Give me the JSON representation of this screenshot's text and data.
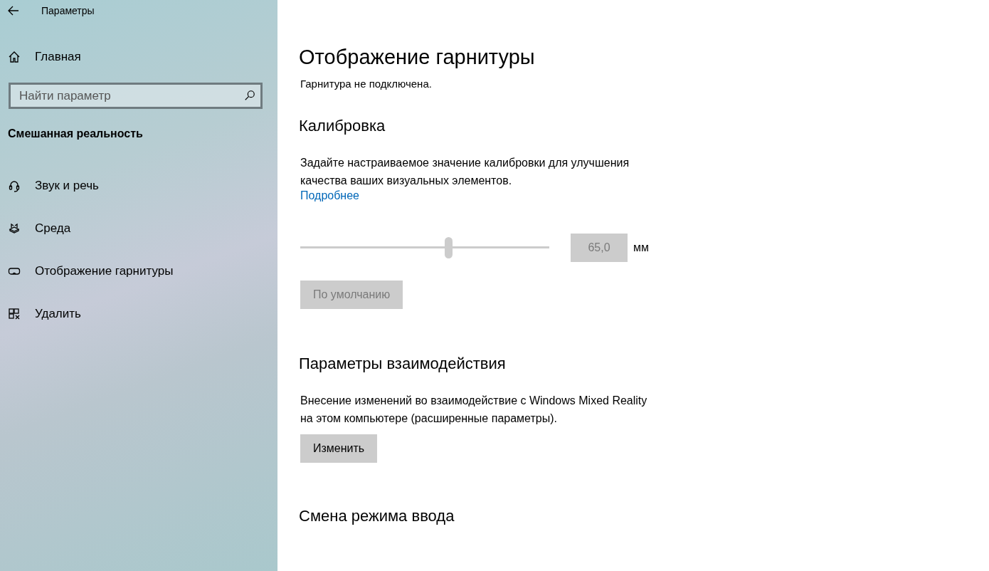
{
  "window": {
    "title": "Параметры"
  },
  "sidebar": {
    "home": {
      "label": "Главная"
    },
    "search": {
      "placeholder": "Найти параметр"
    },
    "section_title": "Смешанная реальность",
    "items": [
      {
        "label": "Звук и речь",
        "kind": "headset"
      },
      {
        "label": "Среда",
        "kind": "environment"
      },
      {
        "label": "Отображение гарнитуры",
        "kind": "display"
      },
      {
        "label": "Удалить",
        "kind": "uninstall"
      }
    ]
  },
  "page": {
    "title": "Отображение гарнитуры",
    "status": "Гарнитура не подключена.",
    "calibration": {
      "heading": "Калибровка",
      "description": "Задайте настраиваемое значение калибровки для улучшения качества ваших визуальных элементов.",
      "link": "Подробнее",
      "slider": {
        "level": 0.594,
        "disabled": true
      },
      "value": "65,0",
      "disabled": true,
      "unit": "мм",
      "default_button": {
        "label": "По умолчанию",
        "disabled": true
      }
    },
    "interaction": {
      "heading": "Параметры взаимодействия",
      "description": "Внесение изменений во взаимодействие с Windows Mixed Reality на этом компьютере (расширенные параметры).",
      "button": {
        "label": "Изменить",
        "disabled": false
      }
    },
    "input_switch": {
      "heading": "Смена режима ввода"
    }
  }
}
